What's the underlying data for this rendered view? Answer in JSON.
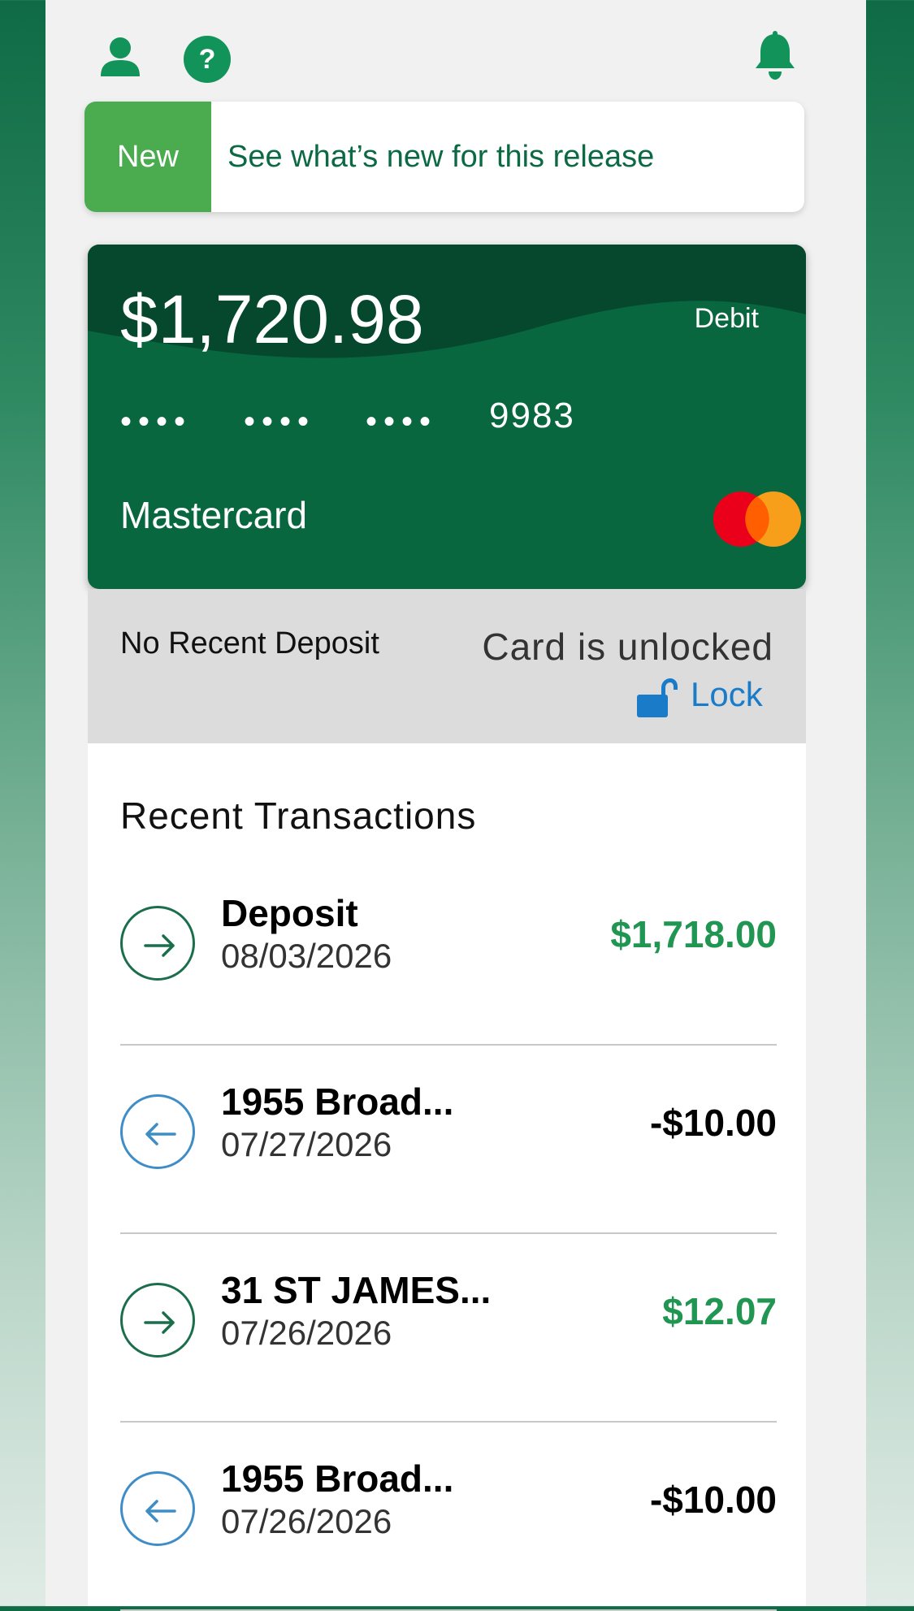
{
  "header": {
    "user_icon": "user-icon",
    "help_icon": "help-icon",
    "help_glyph": "?",
    "bell_icon": "bell-icon"
  },
  "whats_new": {
    "tag": "New",
    "text": "See what’s new for this release"
  },
  "card": {
    "balance": "$1,720.98",
    "type": "Debit",
    "masked_groups": [
      "••••",
      "••••",
      "••••"
    ],
    "last4": "9983",
    "brand": "Mastercard",
    "brand_icon": "mastercard-logo"
  },
  "status": {
    "deposit_text": "No Recent Deposit",
    "lock_status": "Card is unlocked",
    "lock_action": "Lock",
    "lock_icon": "unlocked-padlock-icon"
  },
  "transactions": {
    "heading": "Recent Transactions",
    "items": [
      {
        "name": "Deposit",
        "date": "08/03/2026",
        "amount": "$1,718.00",
        "direction": "in"
      },
      {
        "name": "1955 Broad...",
        "date": "07/27/2026",
        "amount": "-$10.00",
        "direction": "out"
      },
      {
        "name": "31 ST JAMES...",
        "date": "07/26/2026",
        "amount": "$12.07",
        "direction": "in"
      },
      {
        "name": "1955 Broad...",
        "date": "07/26/2026",
        "amount": "-$10.00",
        "direction": "out"
      }
    ]
  },
  "colors": {
    "brand_green": "#08673f",
    "accent_green": "#4aab4f",
    "positive_amount": "#219552",
    "link_blue": "#1a7cc8"
  }
}
